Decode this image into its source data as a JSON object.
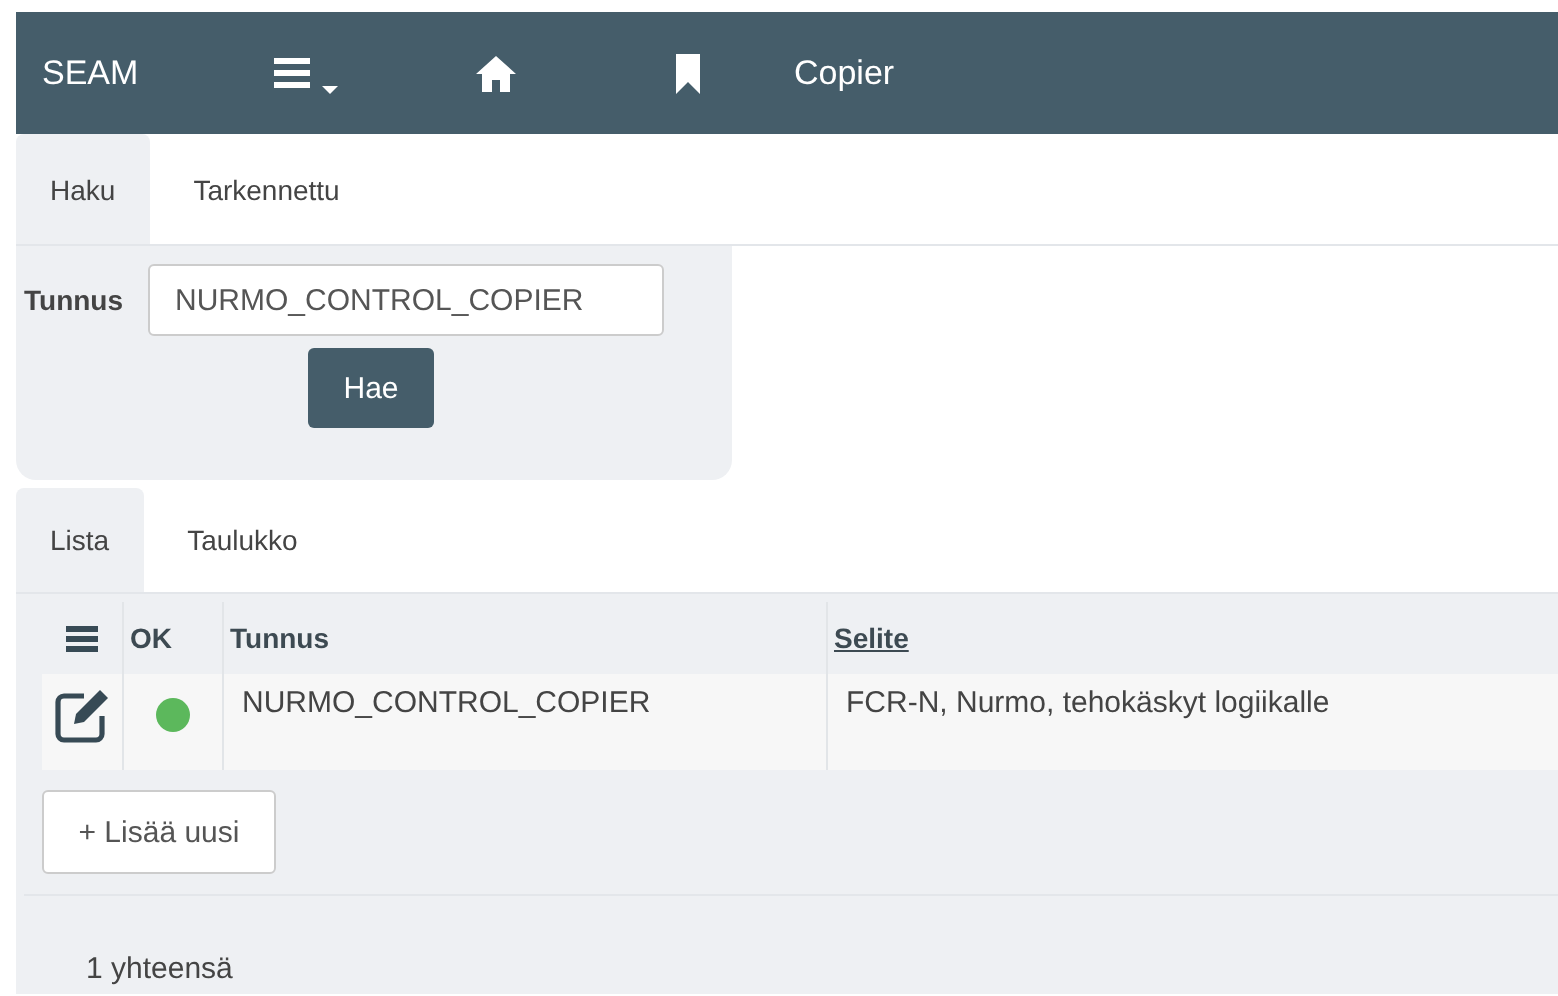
{
  "navbar": {
    "brand": "SEAM",
    "title": "Copier"
  },
  "search_tabs": [
    {
      "label": "Haku",
      "selected": true
    },
    {
      "label": "Tarkennettu",
      "selected": false
    }
  ],
  "search": {
    "label": "Tunnus",
    "value": "NURMO_CONTROL_COPIER",
    "button": "Hae"
  },
  "list_tabs": [
    {
      "label": "Lista",
      "selected": true
    },
    {
      "label": "Taulukko",
      "selected": false
    }
  ],
  "table": {
    "columns": [
      "OK",
      "Tunnus",
      "Selite"
    ],
    "rows": [
      {
        "ok": true,
        "tunnus": "NURMO_CONTROL_COPIER",
        "selite": "FCR-N, Nurmo, tehokäskyt logiikalle"
      }
    ]
  },
  "add_button": "+ Lisää uusi",
  "total": "1 yhteensä"
}
